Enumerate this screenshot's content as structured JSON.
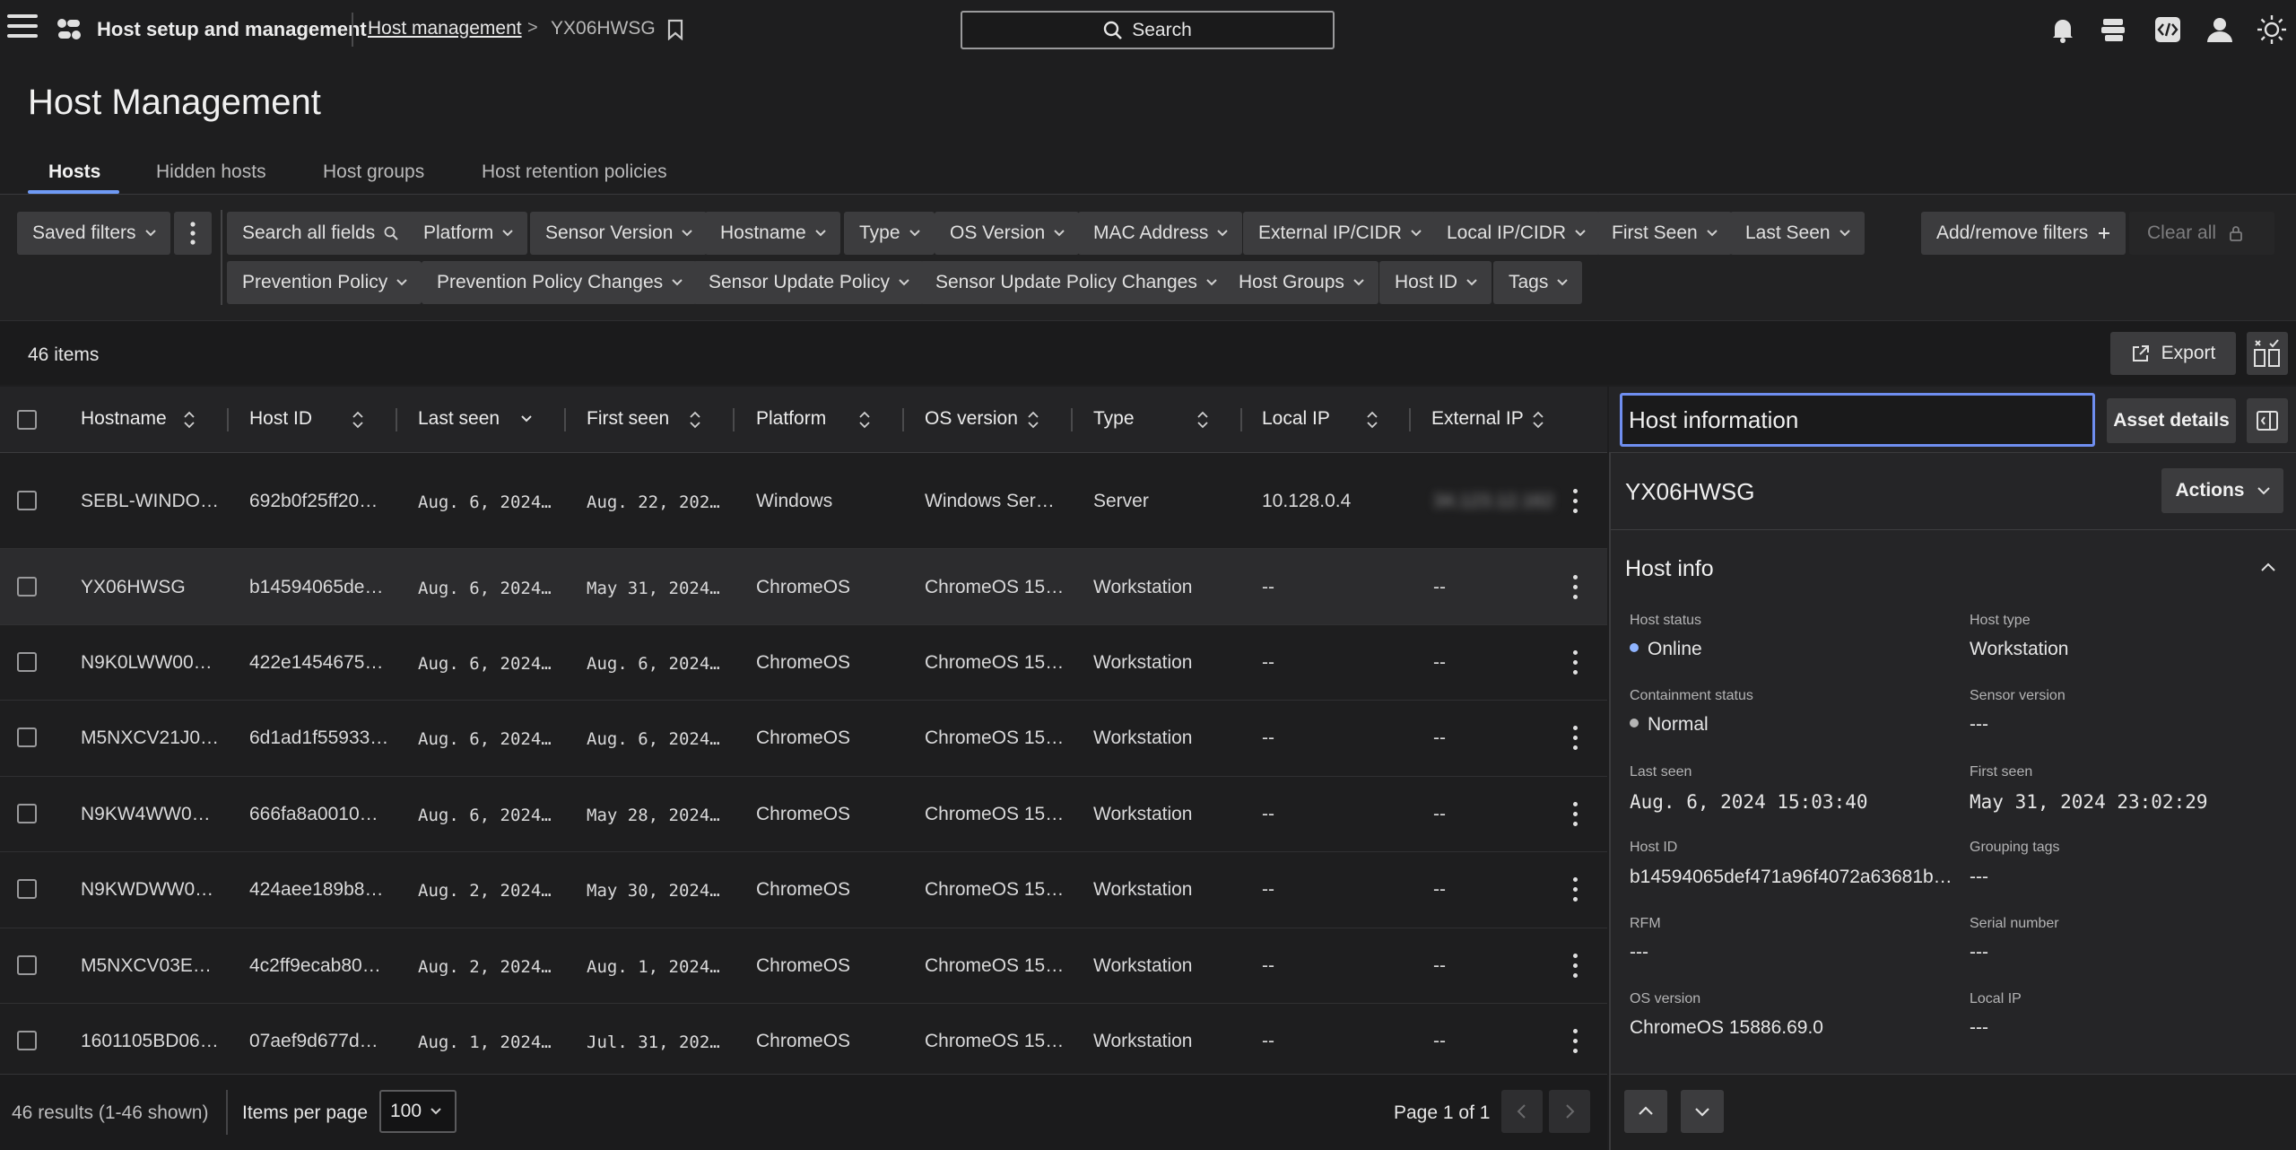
{
  "header": {
    "app_name": "Host setup and management",
    "breadcrumb_link": "Host management",
    "breadcrumb_sep": ">",
    "breadcrumb_current": "YX06HWSG",
    "search_label": "Search"
  },
  "page_title": "Host Management",
  "tabs": [
    {
      "label": "Hosts",
      "active": true
    },
    {
      "label": "Hidden hosts"
    },
    {
      "label": "Host groups"
    },
    {
      "label": "Host retention policies"
    }
  ],
  "filters": {
    "saved_filters": "Saved filters",
    "row1": [
      "Search all fields",
      "Platform",
      "Sensor Version",
      "Hostname",
      "Type",
      "OS Version",
      "MAC Address",
      "External IP/CIDR",
      "Local IP/CIDR",
      "First Seen",
      "Last Seen"
    ],
    "row2": [
      "Prevention Policy",
      "Prevention Policy Changes",
      "Sensor Update Policy",
      "Sensor Update Policy Changes",
      "Host Groups",
      "Host ID",
      "Tags"
    ],
    "add_remove": "Add/remove filters",
    "clear_all": "Clear all"
  },
  "items_count": "46 items",
  "export_label": "Export",
  "table": {
    "columns": [
      "Hostname",
      "Host ID",
      "Last seen",
      "First seen",
      "Platform",
      "OS version",
      "Type",
      "Local IP",
      "External IP"
    ],
    "rows": [
      {
        "hostname": "SEBL-WINDO…",
        "host_id": "692b0f25ff20…",
        "last_seen": "Aug. 6, 2024…",
        "first_seen": "Aug. 22, 202…",
        "platform": "Windows",
        "os_version": "Windows Ser…",
        "type": "Server",
        "local_ip": "10.128.0.4",
        "external_ip": "34.123.12.162"
      },
      {
        "hostname": "YX06HWSG",
        "host_id": "b14594065de…",
        "last_seen": "Aug. 6, 2024…",
        "first_seen": "May 31, 2024…",
        "platform": "ChromeOS",
        "os_version": "ChromeOS 15…",
        "type": "Workstation",
        "local_ip": "--",
        "external_ip": "--"
      },
      {
        "hostname": "N9K0LWW00…",
        "host_id": "422e1454675…",
        "last_seen": "Aug. 6, 2024…",
        "first_seen": "Aug. 6, 2024…",
        "platform": "ChromeOS",
        "os_version": "ChromeOS 15…",
        "type": "Workstation",
        "local_ip": "--",
        "external_ip": "--"
      },
      {
        "hostname": "M5NXCV21J0…",
        "host_id": "6d1ad1f55933…",
        "last_seen": "Aug. 6, 2024…",
        "first_seen": "Aug. 6, 2024…",
        "platform": "ChromeOS",
        "os_version": "ChromeOS 15…",
        "type": "Workstation",
        "local_ip": "--",
        "external_ip": "--"
      },
      {
        "hostname": "N9KW4WW0…",
        "host_id": "666fa8a0010…",
        "last_seen": "Aug. 6, 2024…",
        "first_seen": "May 28, 2024…",
        "platform": "ChromeOS",
        "os_version": "ChromeOS 15…",
        "type": "Workstation",
        "local_ip": "--",
        "external_ip": "--"
      },
      {
        "hostname": "N9KWDWW0…",
        "host_id": "424aee189b8…",
        "last_seen": "Aug. 2, 2024…",
        "first_seen": "May 30, 2024…",
        "platform": "ChromeOS",
        "os_version": "ChromeOS 15…",
        "type": "Workstation",
        "local_ip": "--",
        "external_ip": "--"
      },
      {
        "hostname": "M5NXCV03E…",
        "host_id": "4c2ff9ecab80…",
        "last_seen": "Aug. 2, 2024…",
        "first_seen": "Aug. 1, 2024…",
        "platform": "ChromeOS",
        "os_version": "ChromeOS 15…",
        "type": "Workstation",
        "local_ip": "--",
        "external_ip": "--"
      },
      {
        "hostname": "1601105BD06…",
        "host_id": "07aef9d677d…",
        "last_seen": "Aug. 1, 2024…",
        "first_seen": "Jul. 31, 202…",
        "platform": "ChromeOS",
        "os_version": "ChromeOS 15…",
        "type": "Workstation",
        "local_ip": "--",
        "external_ip": "--"
      }
    ]
  },
  "footer": {
    "results": "46 results (1-46 shown)",
    "items_per_page_label": "Items per page",
    "items_per_page_value": "100",
    "page_info": "Page 1 of 1"
  },
  "panel": {
    "title": "Host information",
    "asset_details": "Asset details",
    "host_name": "YX06HWSG",
    "actions": "Actions",
    "section_title": "Host info",
    "fields": [
      {
        "label": "Host status",
        "value": "Online",
        "dot": "#8fb4ff"
      },
      {
        "label": "Host type",
        "value": "Workstation"
      },
      {
        "label": "Containment status",
        "value": "Normal",
        "dot": "#b5b5b5"
      },
      {
        "label": "Sensor version",
        "value": "---"
      },
      {
        "label": "Last seen",
        "value": "Aug. 6, 2024 15:03:40",
        "mono": true
      },
      {
        "label": "First seen",
        "value": "May 31, 2024 23:02:29",
        "mono": true
      },
      {
        "label": "Host ID",
        "value": "b14594065def471a96f4072a63681b…"
      },
      {
        "label": "Grouping tags",
        "value": "---"
      },
      {
        "label": "RFM",
        "value": "---"
      },
      {
        "label": "Serial number",
        "value": "---"
      },
      {
        "label": "OS version",
        "value": "ChromeOS 15886.69.0"
      },
      {
        "label": "Local IP",
        "value": "---"
      }
    ]
  },
  "colors": {
    "accent": "#6f9af5",
    "focus": "#6f8ef0",
    "background": "#1e1e1f",
    "chip": "#3c3c3e"
  }
}
